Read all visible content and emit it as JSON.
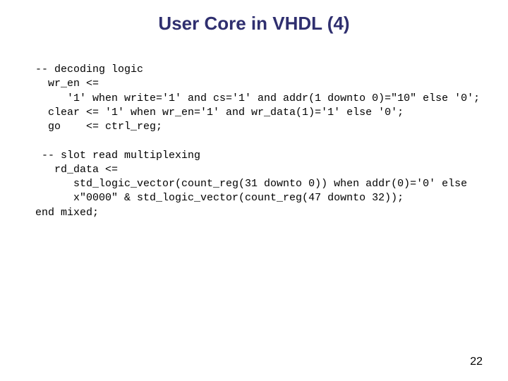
{
  "title": "User Core in VHDL (4)",
  "code_lines": {
    "l1": "-- decoding logic",
    "l2": "  wr_en <=",
    "l3": "     '1' when write='1' and cs='1' and addr(1 downto 0)=\"10\" else '0';",
    "l4": "  clear <= '1' when wr_en='1' and wr_data(1)='1' else '0';",
    "l5": "  go    <= ctrl_reg;",
    "l6": "",
    "l7": " -- slot read multiplexing",
    "l8": "   rd_data <=",
    "l9": "      std_logic_vector(count_reg(31 downto 0)) when addr(0)='0' else",
    "l10": "      x\"0000\" & std_logic_vector(count_reg(47 downto 32));",
    "l11": "end mixed;"
  },
  "page_number": "22"
}
